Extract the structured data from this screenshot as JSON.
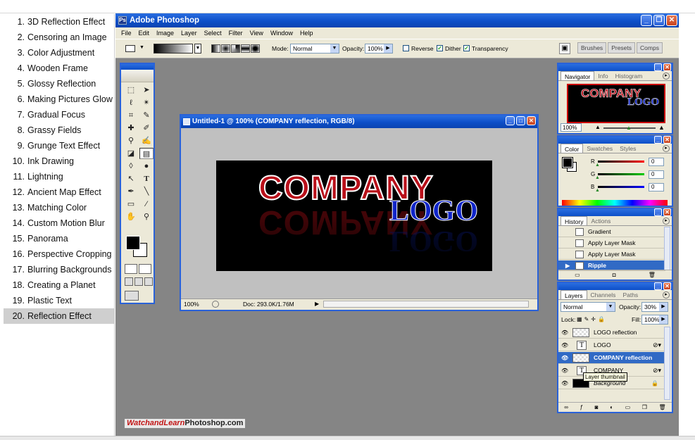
{
  "tutorials": [
    {
      "num": "1.",
      "label": "3D Reflection Effect"
    },
    {
      "num": "2.",
      "label": "Censoring an Image"
    },
    {
      "num": "3.",
      "label": "Color Adjustment"
    },
    {
      "num": "4.",
      "label": "Wooden Frame"
    },
    {
      "num": "5.",
      "label": "Glossy Reflection"
    },
    {
      "num": "6.",
      "label": "Making Pictures Glow"
    },
    {
      "num": "7.",
      "label": "Gradual Focus"
    },
    {
      "num": "8.",
      "label": "Grassy Fields"
    },
    {
      "num": "9.",
      "label": "Grunge Text Effect"
    },
    {
      "num": "10.",
      "label": "Ink Drawing"
    },
    {
      "num": "11.",
      "label": "Lightning"
    },
    {
      "num": "12.",
      "label": "Ancient Map Effect"
    },
    {
      "num": "13.",
      "label": "Matching Color"
    },
    {
      "num": "14.",
      "label": "Custom Motion Blur"
    },
    {
      "num": "15.",
      "label": "Panorama"
    },
    {
      "num": "16.",
      "label": "Perspective Cropping"
    },
    {
      "num": "17.",
      "label": "Blurring Backgrounds"
    },
    {
      "num": "18.",
      "label": "Creating a Planet"
    },
    {
      "num": "19.",
      "label": "Plastic Text"
    },
    {
      "num": "20.",
      "label": "Reflection Effect"
    }
  ],
  "active_tutorial": 19,
  "app": {
    "title": "Adobe Photoshop",
    "menu": [
      "File",
      "Edit",
      "Image",
      "Layer",
      "Select",
      "Filter",
      "View",
      "Window",
      "Help"
    ]
  },
  "options": {
    "mode_label": "Mode:",
    "mode_value": "Normal",
    "opacity_label": "Opacity:",
    "opacity_value": "100%",
    "reverse_label": "Reverse",
    "reverse_checked": false,
    "dither_label": "Dither",
    "dither_checked": true,
    "transparency_label": "Transparency",
    "transparency_checked": true,
    "wells": [
      "Brushes",
      "Presets",
      "Comps"
    ]
  },
  "document": {
    "title": "Untitled-1 @ 100% (COMPANY reflection, RGB/8)",
    "image_text_1": "COMPANY",
    "image_text_2": "LOGO",
    "zoom": "100%",
    "doc_info": "Doc: 293.0K/1.76M"
  },
  "navigator": {
    "tabs": [
      "Navigator",
      "Info",
      "Histogram"
    ],
    "zoom": "100%"
  },
  "color_palette": {
    "tabs": [
      "Color",
      "Swatches",
      "Styles"
    ],
    "r_label": "R",
    "r_value": "0",
    "g_label": "G",
    "g_value": "0",
    "b_label": "B",
    "b_value": "0"
  },
  "history": {
    "tabs": [
      "History",
      "Actions"
    ],
    "items": [
      "Gradient",
      "Apply Layer Mask",
      "Apply Layer Mask",
      "Ripple"
    ],
    "selected_index": 3
  },
  "layers": {
    "tabs": [
      "Layers",
      "Channels",
      "Paths"
    ],
    "blend_mode": "Normal",
    "opacity_label": "Opacity:",
    "opacity_value": "30%",
    "lock_label": "Lock:",
    "fill_label": "Fill:",
    "fill_value": "100%",
    "items": [
      "LOGO reflection",
      "LOGO",
      "COMPANY reflection",
      "COMPANY",
      "Background"
    ],
    "selected_index": 2,
    "tooltip": "Layer thumbnail"
  },
  "watermark": {
    "part1": "WatchandLearn",
    "part2": "Photoshop.com"
  },
  "colors": {
    "title_bar": "#0d4fc8",
    "selection": "#316ac5",
    "company_red": "#b9101a",
    "logo_blue": "#1025c8"
  }
}
